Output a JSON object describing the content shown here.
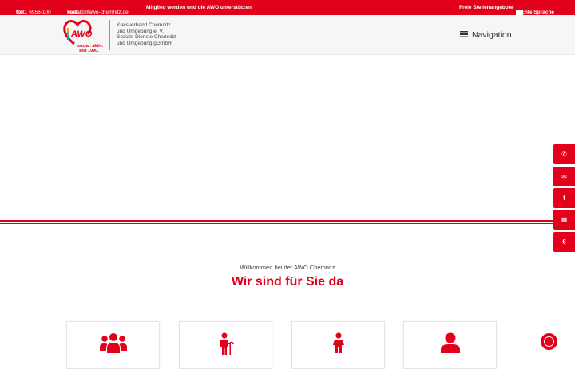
{
  "topbar": {
    "phone_label": "fon.",
    "phone_value": "0371 6956-100",
    "mail_label": "mail.",
    "mail_value": "kontakt@awo-chemnitz.de",
    "member_link": "Mitglied werden und die AWO unterstützen",
    "jobs_link": "Freie Stellenangebote",
    "language_link": "leichte Sprache"
  },
  "header": {
    "logo_text": "AWO",
    "logo_slogan": "sozial. aktiv.",
    "logo_since": "seit 1990.",
    "org_name": "Kreisverband Chemnitz\nund Umgebung e. V.\nSoziale Dienste Chemnitz\nund Umgebung gGmbH",
    "nav_label": "Navigation"
  },
  "side_buttons": [
    {
      "icon": "phone-icon",
      "glyph": "✆"
    },
    {
      "icon": "mail-icon",
      "glyph": "✉"
    },
    {
      "icon": "facebook-icon",
      "glyph": "f"
    },
    {
      "icon": "newsletter-icon",
      "glyph": "▦"
    },
    {
      "icon": "donate-icon",
      "glyph": "€"
    }
  ],
  "welcome": {
    "intro": "Willkommen bei der AWO Chemnitz",
    "headline": "Wir sind für Sie da"
  },
  "cards": [
    {
      "icon": "group-icon"
    },
    {
      "icon": "senior-icon"
    },
    {
      "icon": "child-icon"
    },
    {
      "icon": "person-icon"
    }
  ],
  "colors": {
    "brand": "#e2001a"
  }
}
